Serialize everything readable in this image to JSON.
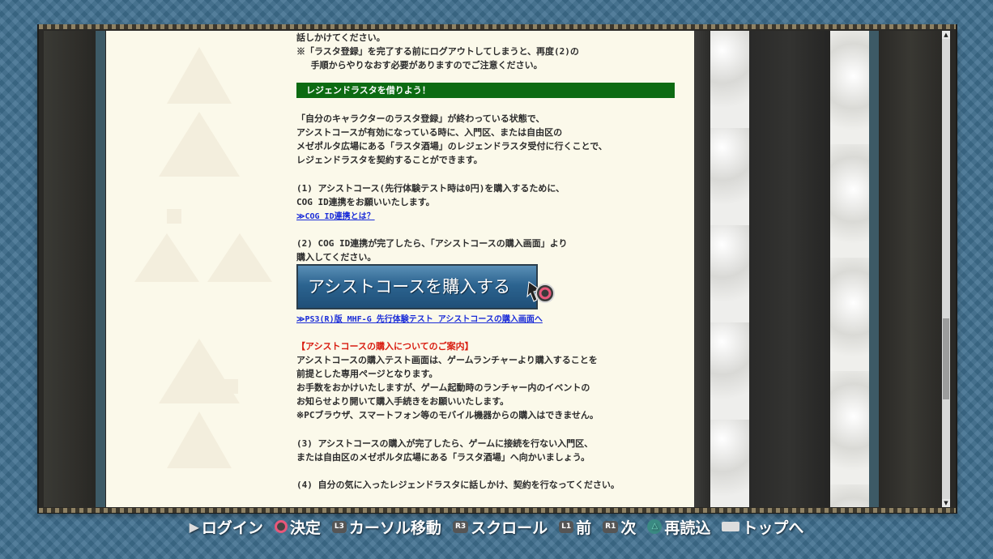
{
  "content": {
    "intro_lines": [
      "話しかけてください。",
      "※「ラスタ登録」を完了する前にログアウトしてしまうと、再度(2)の",
      "　 手順からやりなおす必要がありますのでご注意ください。"
    ],
    "section_header": "レジェンドラスタを借りよう！",
    "section_lines": [
      "「自分のキャラクターのラスタ登録」が終わっている状態で、",
      "アシストコースが有効になっている時に、入門区、または自由区の",
      "メゼポルタ広場にある「ラスタ酒場」のレジェンドラスタ受付に行くことで、",
      "レジェンドラスタを契約することができます。"
    ],
    "step1_lines": [
      "(1) アシストコース(先行体験テスト時は0円)を購入するために、",
      "COG ID連携をお願いいたします。"
    ],
    "step1_link": "≫COG ID連携とは？",
    "step2_lines": [
      "(2) COG ID連携が完了したら、「アシストコースの購入画面」より",
      "購入してください。"
    ],
    "buy_button_label": "アシストコースを購入する",
    "buy_link": "≫PS3(R)版 MHF-G 先行体験テスト アシストコースの購入画面へ",
    "notice_title": "【アシストコースの購入についてのご案内】",
    "notice_lines": [
      "アシストコースの購入テスト画面は、ゲームランチャーより購入することを",
      "前提とした専用ページとなります。",
      "お手数をおかけいたしますが、ゲーム起動時のランチャー内のイベントの",
      "お知らせより開いて購入手続きをお願いいたします。",
      "※PCブラウザ、スマートフォン等のモバイル機器からの購入はできません。"
    ],
    "step3_lines": [
      "(3) アシストコースの購入が完了したら、ゲームに接続を行ない入門区、",
      "または自由区のメゼポルタ広場にある「ラスタ酒場」へ向かいましょう。"
    ],
    "step4_lines": [
      "(4) 自分の気に入ったレジェンドラスタに話しかけ、契約を行なってください。"
    ]
  },
  "controls": [
    {
      "icon": "play-icon",
      "label": "ログイン"
    },
    {
      "icon": "circle-button-icon",
      "label": "決定"
    },
    {
      "icon": "l3-button-icon",
      "icon_text": "L3",
      "label": "カーソル移動"
    },
    {
      "icon": "r3-button-icon",
      "icon_text": "R3",
      "label": "スクロール"
    },
    {
      "icon": "l1-button-icon",
      "icon_text": "L1",
      "label": "前"
    },
    {
      "icon": "r1-button-icon",
      "icon_text": "R1",
      "label": "次"
    },
    {
      "icon": "triangle-button-icon",
      "label": "再読込"
    },
    {
      "icon": "select-button-icon",
      "label": "トップへ"
    }
  ],
  "colors": {
    "header_green": "#0c6b12",
    "link_blue": "#1a2cd8",
    "notice_red": "#d81c10",
    "page_bg": "#fbf9ea"
  }
}
